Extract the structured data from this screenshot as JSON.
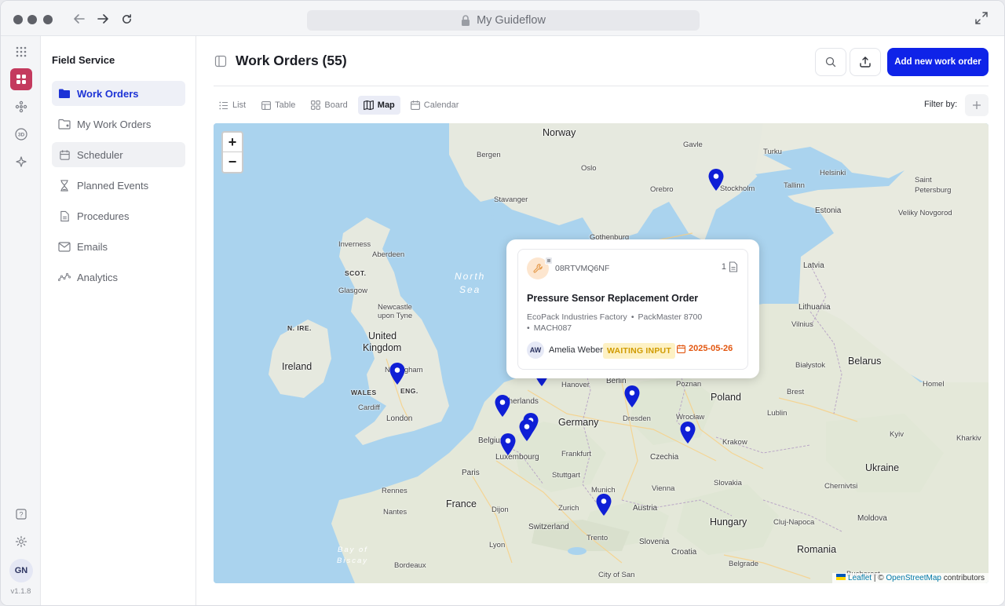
{
  "browser": {
    "url_title": "My Guideflow"
  },
  "rail": {
    "items": [
      "apps-grid-icon",
      "dashboard-icon",
      "integrations-icon",
      "3d-icon",
      "sparkles-icon"
    ],
    "version": "v1.1.8",
    "user_initials": "GN"
  },
  "sidebar": {
    "title": "Field Service",
    "items": [
      {
        "label": "Work Orders",
        "icon": "folder-icon"
      },
      {
        "label": "My Work Orders",
        "icon": "my-folder-icon"
      },
      {
        "label": "Scheduler",
        "icon": "calendar-icon"
      },
      {
        "label": "Planned Events",
        "icon": "hourglass-icon"
      },
      {
        "label": "Procedures",
        "icon": "document-icon"
      },
      {
        "label": "Emails",
        "icon": "mail-icon"
      },
      {
        "label": "Analytics",
        "icon": "analytics-icon"
      }
    ]
  },
  "header": {
    "title": "Work Orders (55)",
    "add_button": "Add new work order"
  },
  "views": {
    "tabs": [
      "List",
      "Table",
      "Board",
      "Map",
      "Calendar"
    ],
    "active": "Map",
    "filter_label": "Filter by:"
  },
  "map": {
    "zoom_in": "+",
    "zoom_out": "−",
    "labels": {
      "norway": "Norway",
      "gavle": "Gavle",
      "turku": "Turku",
      "helsinki": "Helsinki",
      "saint": "Saint",
      "petersburg": "Petersburg",
      "bergen": "Bergen",
      "oslo": "Oslo",
      "orebro": "Orebro",
      "stockholm": "Stockholm",
      "tallinn": "Tallinn",
      "stavanger": "Stavanger",
      "estonia": "Estonia",
      "veliky": "Veliky Novgorod",
      "gothenburg": "Gothenburg",
      "inverness": "Inverness",
      "aberdeen": "Aberdeen",
      "scot": "SCOT.",
      "north": "North",
      "sea": "Sea",
      "latvia": "Latvia",
      "glasgow": "Glasgow",
      "newcastle": "Newcastle",
      "upon_tyne": "upon Tyne",
      "lithuania": "Lithuania",
      "nire": "N. IRE.",
      "vilnius": "Vilnius",
      "united": "United",
      "kingdom": "Kingdom",
      "ireland": "Ireland",
      "nottingham": "Nottingham",
      "berlin": "Berlin",
      "poznan": "Poznan",
      "belarus": "Belarus",
      "hanover": "Hanover",
      "wales": "WALES",
      "eng": "ENG.",
      "bialystok": "Białystok",
      "poland": "Poland",
      "brest": "Brest",
      "homel": "Homel",
      "netherlands": "Netherlands",
      "cardiff": "Cardiff",
      "dresden": "Dresden",
      "wroclaw": "Wrocław",
      "lublin": "Lublin",
      "london": "London",
      "germany": "Germany",
      "belgium": "Belgium",
      "kyiv": "Kyiv",
      "kharkiv": "Kharkiv",
      "luxembourg": "Luxembourg",
      "frankfurt": "Frankfurt",
      "czechia": "Czechia",
      "krakow": "Krakow",
      "paris": "Paris",
      "stuttgart": "Stuttgart",
      "ukraine": "Ukraine",
      "slovakia": "Slovakia",
      "rennes": "Rennes",
      "munich": "Munich",
      "vienna": "Vienna",
      "chernivtsi": "Chernivtsi",
      "france": "France",
      "zurich": "Zurich",
      "austria": "Austria",
      "nantes": "Nantes",
      "dijon": "Dijon",
      "hungary": "Hungary",
      "cluj": "Cluj-Napoca",
      "moldova": "Moldova",
      "switzerland": "Switzerland",
      "bay": "Bay of",
      "biscay": "Biscay",
      "lyon": "Lyon",
      "trento": "Trento",
      "slovenia": "Slovenia",
      "romania": "Romania",
      "bordeaux": "Bordeaux",
      "croatia": "Croatia",
      "belgrade": "Belgrade",
      "city_of_san": "City of San",
      "bucharest": "Bucharest"
    },
    "attribution": {
      "leaflet": "Leaflet",
      "separator": "| ©",
      "osm": "OpenStreetMap",
      "contributors": "contributors"
    }
  },
  "popup": {
    "code": "08RTVMQ6NF",
    "attachment_count": "1",
    "title": "Pressure Sensor Replacement Order",
    "location": "EcoPack Industries Factory",
    "asset": "PackMaster 8700",
    "asset_id": "MACH087",
    "assignee_initials": "AW",
    "assignee": "Amelia Weber",
    "status": "WAITING INPUT",
    "due_date": "2025-05-26"
  }
}
